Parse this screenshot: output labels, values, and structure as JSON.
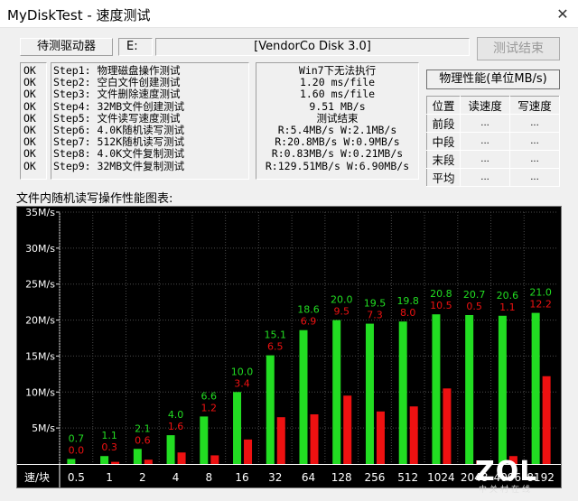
{
  "window": {
    "title": "MyDiskTest - 速度测试",
    "close_glyph": "✕"
  },
  "drive": {
    "label": "待测驱动器",
    "letter": "E:",
    "name": "[VendorCo Disk 3.0]"
  },
  "stop_button": "测试结束",
  "steps": [
    {
      "status": "OK",
      "text": "Step1: 物理磁盘操作测试"
    },
    {
      "status": "OK",
      "text": "Step2: 空白文件创建测试"
    },
    {
      "status": "OK",
      "text": "Step3: 文件删除速度测试"
    },
    {
      "status": "OK",
      "text": "Step4: 32MB文件创建测试"
    },
    {
      "status": "OK",
      "text": "Step5: 文件读写速度测试"
    },
    {
      "status": "OK",
      "text": "Step6: 4.0K随机读写测试"
    },
    {
      "status": "OK",
      "text": "Step7: 512K随机读写测试"
    },
    {
      "status": "OK",
      "text": "Step8: 4.0K文件复制测试"
    },
    {
      "status": "OK",
      "text": "Step9: 32MB文件复制测试"
    }
  ],
  "results": [
    "Win7下无法执行",
    "1.20 ms/file",
    "1.60 ms/file",
    "9.51 MB/s",
    "测试结束",
    "R:5.4MB/s W:2.1MB/s",
    "R:20.8MB/s W:0.9MB/s",
    "R:0.83MB/s W:0.21MB/s",
    "R:129.51MB/s W:6.90MB/s"
  ],
  "perf": {
    "title": "物理性能(单位MB/s)",
    "headers": [
      "位置",
      "读速度",
      "写速度"
    ],
    "rows": [
      {
        "pos": "前段",
        "read": "...",
        "write": "..."
      },
      {
        "pos": "中段",
        "read": "...",
        "write": "..."
      },
      {
        "pos": "末段",
        "read": "...",
        "write": "..."
      },
      {
        "pos": "平均",
        "read": "...",
        "write": "..."
      }
    ]
  },
  "chart_label": "文件内随机读写操作性能图表:",
  "chart_data": {
    "type": "bar",
    "corner_label": "速/块",
    "categories": [
      "0.5",
      "1",
      "2",
      "4",
      "8",
      "16",
      "32",
      "64",
      "128",
      "256",
      "512",
      "1024",
      "2048",
      "4096",
      "8192"
    ],
    "series": [
      {
        "values": [
          0.7,
          1.1,
          2.1,
          4.0,
          6.6,
          10.0,
          15.1,
          18.6,
          20.0,
          19.5,
          19.8,
          20.8,
          20.7,
          20.6,
          21.0
        ],
        "color": "#22dd22"
      },
      {
        "values": [
          0.0,
          0.3,
          0.6,
          1.6,
          1.2,
          3.4,
          6.5,
          6.9,
          9.5,
          7.3,
          8.0,
          10.5,
          0.5,
          1.1,
          12.2
        ],
        "color": "#ee1111"
      }
    ],
    "y_ticks": [
      "5M/s",
      "10M/s",
      "15M/s",
      "20M/s",
      "25M/s",
      "30M/s",
      "35M/s"
    ],
    "ylim": [
      0,
      35
    ],
    "grid": true
  },
  "watermark": {
    "main": "ZOL",
    "sub": "中关村在线"
  }
}
